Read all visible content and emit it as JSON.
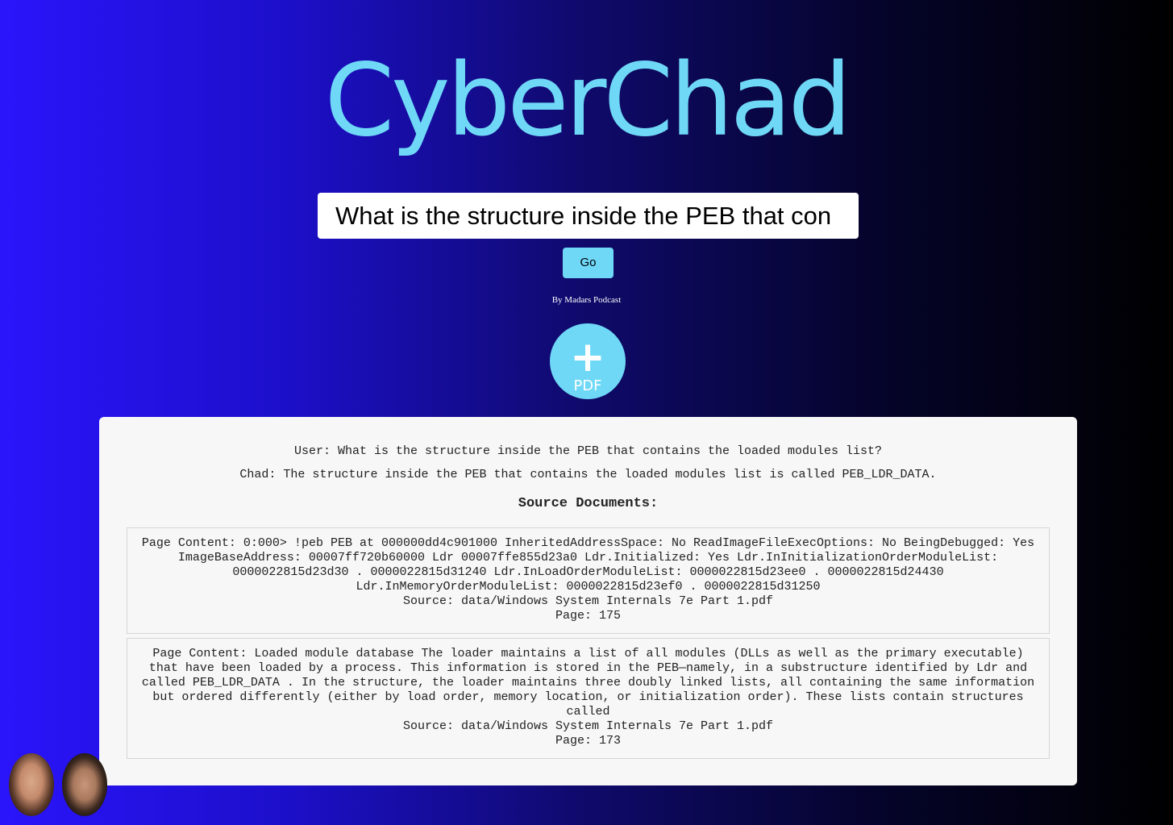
{
  "header": {
    "title": "CyberChad"
  },
  "search": {
    "value": "What is the structure inside the PEB that con"
  },
  "go_button": {
    "label": "Go"
  },
  "byline": "By Madars Podcast",
  "upload": {
    "label": "PDF",
    "icon": "plus-icon"
  },
  "conversation": {
    "user": "User: What is the structure inside the PEB that contains the loaded modules list?",
    "chad": "Chad: The structure inside the PEB that contains the loaded modules list is called PEB_LDR_DATA."
  },
  "sources": {
    "heading": "Source Documents:",
    "documents": [
      {
        "content": "Page Content: 0:000> !peb PEB at 000000dd4c901000 InheritedAddressSpace: No ReadImageFileExecOptions: No BeingDebugged: Yes ImageBaseAddress: 00007ff720b60000 Ldr 00007ffe855d23a0 Ldr.Initialized: Yes Ldr.InInitializationOrderModuleList: 0000022815d23d30 . 0000022815d31240 Ldr.InLoadOrderModuleList: 0000022815d23ee0 . 0000022815d24430 Ldr.InMemoryOrderModuleList: 0000022815d23ef0 . 0000022815d31250",
        "source": "Source: data/Windows System Internals 7e Part 1.pdf",
        "page": "Page: 175"
      },
      {
        "content": "Page Content: Loaded module database The loader maintains a list of all modules (DLLs as well as the primary executable) that have been loaded by a process. This information is stored in the PEB—namely, in a substructure identified by Ldr and called PEB_LDR_DATA . In the structure, the loader maintains three doubly linked lists, all containing the same information but ordered differently (either by load order, memory location, or initialization order). These lists contain structures called",
        "source": "Source: data/Windows System Internals 7e Part 1.pdf",
        "page": "Page: 173"
      }
    ]
  },
  "avatars": [
    "avatar-photo-1",
    "avatar-photo-2"
  ],
  "colors": {
    "accent": "#6fd8f7",
    "panel": "#f7f7f7"
  }
}
